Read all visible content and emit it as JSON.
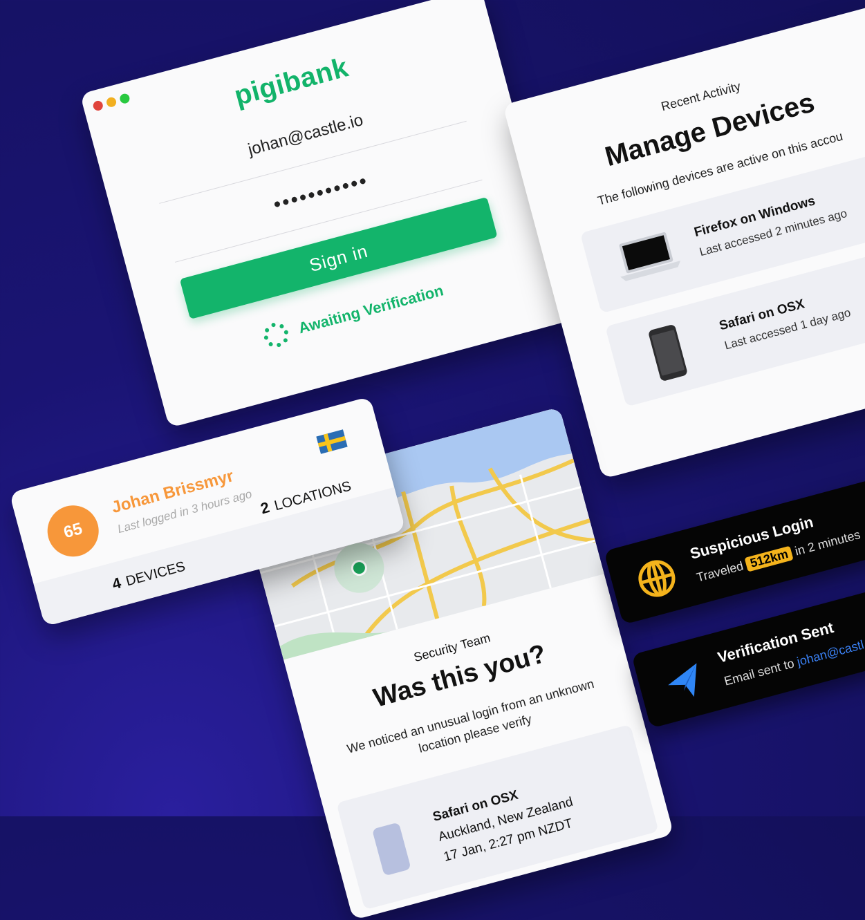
{
  "login": {
    "logo": "pigibank",
    "email_value": "johan@castle.io",
    "password_value": "•••••••••••",
    "signin_label": "Sign in",
    "status_text": "Awaiting Verification",
    "window_dots": [
      "#e0443c",
      "#f2b021",
      "#29c940"
    ]
  },
  "devices": {
    "eyebrow": "Recent Activity",
    "title": "Manage Devices",
    "description": "The following devices are active on this accou",
    "items": [
      {
        "title": "Firefox on Windows",
        "subtitle": "Last accessed 2 minutes ago",
        "icon": "laptop-icon"
      },
      {
        "title": "Safari on OSX",
        "subtitle": "Last accessed 1 day ago",
        "icon": "phone-icon"
      }
    ]
  },
  "verify": {
    "eyebrow": "Security Team",
    "title": "Was this you?",
    "description": "We noticed an unusual login from an unknown location please verify",
    "location": {
      "device": "Safari on OSX",
      "place": "Auckland, New Zealand",
      "time": "17 Jan, 2:27 pm NZDT"
    }
  },
  "profile": {
    "score": "65",
    "name": "Johan Brissmyr",
    "last_login": "Last logged in 3 hours ago",
    "devices_count": "4",
    "devices_label": "DEVICES",
    "locations_count": "2",
    "locations_label": "LOCATIONS",
    "flag_icon": "sweden-flag-icon"
  },
  "notifications": [
    {
      "title": "Suspicious Login",
      "prefix": "Traveled",
      "highlight": "512km",
      "suffix": "in 2 minutes",
      "icon": "globe-icon"
    },
    {
      "title": "Verification Sent",
      "prefix": "Email sent to",
      "link": "johan@castl",
      "icon": "paper-plane-icon"
    }
  ],
  "colors": {
    "brand_green": "#13b46b",
    "orange": "#f7973a",
    "link_blue": "#3b82f6",
    "highlight": "#f4b31c"
  }
}
